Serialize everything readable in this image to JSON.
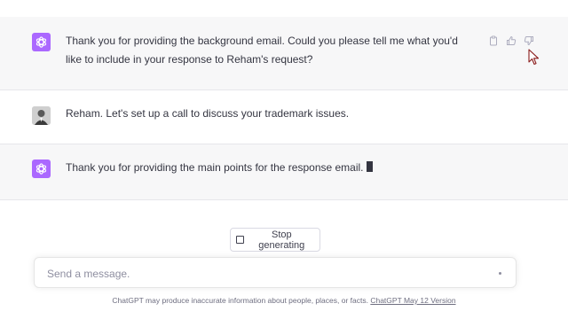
{
  "messages": [
    {
      "role": "assistant",
      "text": "Thank you for providing the background email. Could you please tell me what you'd like to include in your response to Reham's request?"
    },
    {
      "role": "user",
      "text": "Reham. Let's set up a call to discuss your trademark issues."
    },
    {
      "role": "assistant",
      "text": "Thank you for providing the main points for the response email."
    }
  ],
  "message_actions": {
    "icons": [
      "clipboard-icon",
      "thumbs-up-icon",
      "thumbs-down-icon"
    ]
  },
  "stop_button": {
    "label": "Stop generating"
  },
  "composer": {
    "placeholder": "Send a message."
  },
  "footer": {
    "text": "ChatGPT may produce inaccurate information about people, places, or facts.",
    "link": "ChatGPT May 12 Version"
  },
  "colors": {
    "assistant_avatar": "#ab68ff",
    "assistant_bg": "#f7f7f8",
    "text": "#343541"
  }
}
